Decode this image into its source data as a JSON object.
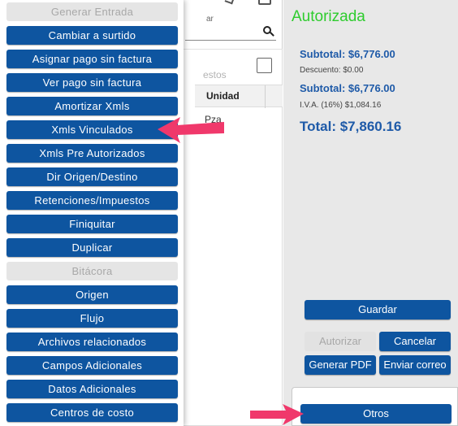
{
  "table": {
    "search_label": "ar",
    "ghost_text": "estos",
    "col_header": "Unidad",
    "cell_value": "Pza"
  },
  "menu": {
    "items": [
      {
        "label": "Generar Entrada",
        "enabled": false
      },
      {
        "label": "Cambiar a surtido",
        "enabled": true
      },
      {
        "label": "Asignar pago sin factura",
        "enabled": true
      },
      {
        "label": "Ver pago sin factura",
        "enabled": true
      },
      {
        "label": "Amortizar Xmls",
        "enabled": true
      },
      {
        "label": "Xmls Vinculados",
        "enabled": true
      },
      {
        "label": "Xmls Pre Autorizados",
        "enabled": true
      },
      {
        "label": "Dir Origen/Destino",
        "enabled": true
      },
      {
        "label": "Retenciones/Impuestos",
        "enabled": true
      },
      {
        "label": "Finiquitar",
        "enabled": true
      },
      {
        "label": "Duplicar",
        "enabled": true
      },
      {
        "label": "Bitácora",
        "enabled": false
      },
      {
        "label": "Origen",
        "enabled": true
      },
      {
        "label": "Flujo",
        "enabled": true
      },
      {
        "label": "Archivos relacionados",
        "enabled": true
      },
      {
        "label": "Campos Adicionales",
        "enabled": true
      },
      {
        "label": "Datos Adicionales",
        "enabled": true
      },
      {
        "label": "Centros de costo",
        "enabled": true
      }
    ]
  },
  "summary": {
    "status": "Autorizada",
    "subtotal1": "Subtotal: $6,776.00",
    "descuento": "Descuento: $0.00",
    "subtotal2": "Subtotal: $6,776.00",
    "iva": "I.V.A. (16%) $1,084.16",
    "total": "Total: $7,860.16"
  },
  "actions": {
    "guardar": "Guardar",
    "autorizar": "Autorizar",
    "cancelar": "Cancelar",
    "generar_pdf": "Generar PDF",
    "enviar_correo": "Enviar correo",
    "otros": "Otros"
  },
  "colors": {
    "button_blue": "#0e55a0",
    "status_green": "#2ecc2e",
    "total_blue": "#1e5aa8",
    "arrow_pink": "#f0386b"
  }
}
